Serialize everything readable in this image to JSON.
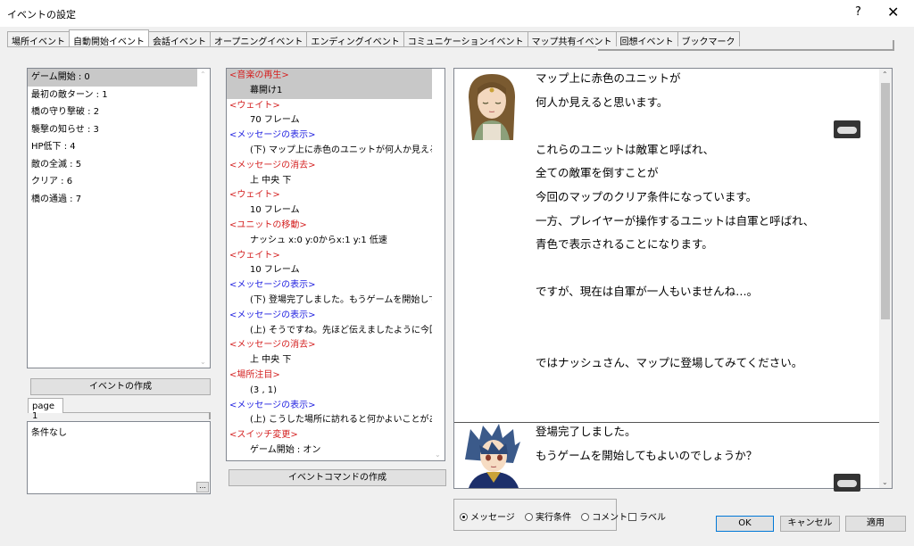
{
  "window": {
    "title": "イベントの設定",
    "help": "?",
    "close": "✕"
  },
  "tabs": [
    "場所イベント",
    "自動開始イベント",
    "会話イベント",
    "オープニングイベント",
    "エンディングイベント",
    "コミュニケーションイベント",
    "マップ共有イベント",
    "回想イベント",
    "ブックマーク"
  ],
  "events": [
    "ゲーム開始 : 0",
    "最初の敵ターン : 1",
    "橋の守り撃破 : 2",
    "襲撃の知らせ : 3",
    "HP低下 : 4",
    "敵の全滅 : 5",
    "クリア : 6",
    "橋の通過 : 7"
  ],
  "create_event_label": "イベントの作成",
  "page_tab": "page 1",
  "condition_text": "条件なし",
  "condition_btn": "...",
  "commands": [
    {
      "text": "<音楽の再生>",
      "kind": "hdr-red"
    },
    {
      "text": "幕開け1",
      "kind": "body"
    },
    {
      "text": "<ウェイト>",
      "kind": "hdr-red"
    },
    {
      "text": "70 フレーム",
      "kind": "body"
    },
    {
      "text": "<メッセージの表示>",
      "kind": "hdr-blue"
    },
    {
      "text": "(下) マップ上に赤色のユニットが何人か見えると思いま",
      "kind": "body"
    },
    {
      "text": "<メッセージの消去>",
      "kind": "hdr-red"
    },
    {
      "text": "上 中央 下",
      "kind": "body"
    },
    {
      "text": "<ウェイト>",
      "kind": "hdr-red"
    },
    {
      "text": "10 フレーム",
      "kind": "body"
    },
    {
      "text": "<ユニットの移動>",
      "kind": "hdr-red"
    },
    {
      "text": "ナッシュ x:0 y:0からx:1 y:1 低速",
      "kind": "body"
    },
    {
      "text": "<ウェイト>",
      "kind": "hdr-red"
    },
    {
      "text": "10 フレーム",
      "kind": "body"
    },
    {
      "text": "<メッセージの表示>",
      "kind": "hdr-blue"
    },
    {
      "text": "(下) 登場完了しました。もうゲームを開始してもよいの",
      "kind": "body"
    },
    {
      "text": "<メッセージの表示>",
      "kind": "hdr-blue"
    },
    {
      "text": "(上) そうですね。先ほど伝えましたように今回の目的は",
      "kind": "body"
    },
    {
      "text": "<メッセージの消去>",
      "kind": "hdr-red"
    },
    {
      "text": "上 中央 下",
      "kind": "body"
    },
    {
      "text": "<場所注目>",
      "kind": "hdr-red"
    },
    {
      "text": "(3 , 1)",
      "kind": "body"
    },
    {
      "text": "<メッセージの表示>",
      "kind": "hdr-blue"
    },
    {
      "text": "(上) こうした場所に訪れると何かよいことがあるかもしれ",
      "kind": "body"
    },
    {
      "text": "<スイッチ変更>",
      "kind": "hdr-red"
    },
    {
      "text": "ゲーム開始 : オン",
      "kind": "body"
    }
  ],
  "create_command_label": "イベントコマンドの作成",
  "preview": {
    "msg1": "マップ上に赤色のユニットが\n何人か見えると思います。\n\nこれらのユニットは敵軍と呼ばれ、\n全ての敵軍を倒すことが\n今回のマップのクリア条件になっています。\n一方、プレイヤーが操作するユニットは自軍と呼ばれ、\n青色で表示されることになります。\n\nですが、現在は自軍が一人もいませんね…。\n\n\nではナッシュさん、マップに登場してみてください。",
    "msg2": "登場完了しました。\nもうゲームを開始してもよいのでしょうか？"
  },
  "view_options": {
    "message": "メッセージ",
    "condition": "実行条件",
    "comment": "コメント",
    "selected": "message"
  },
  "label_checkbox": "ラベル",
  "buttons": {
    "ok": "OK",
    "cancel": "キャンセル",
    "apply": "適用"
  }
}
